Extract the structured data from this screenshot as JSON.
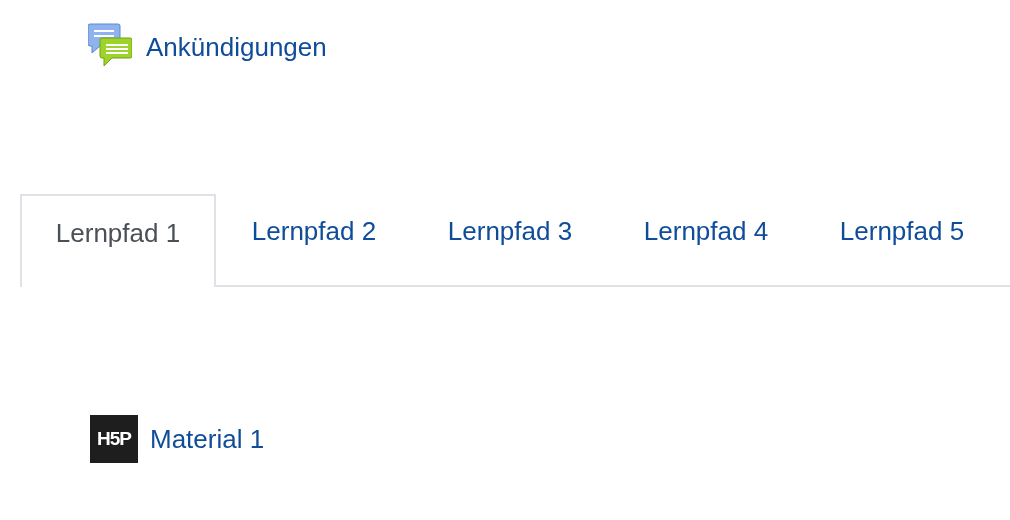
{
  "announcements": {
    "label": "Ankündigungen"
  },
  "tabs": [
    {
      "label": "Lernpfad 1",
      "selected": true
    },
    {
      "label": "Lernpfad 2",
      "selected": false
    },
    {
      "label": "Lernpfad 3",
      "selected": false
    },
    {
      "label": "Lernpfad 4",
      "selected": false
    },
    {
      "label": "Lernpfad 5",
      "selected": false
    }
  ],
  "activities": [
    {
      "kind": "h5p",
      "logo": "H5P",
      "label": "Material 1"
    }
  ]
}
